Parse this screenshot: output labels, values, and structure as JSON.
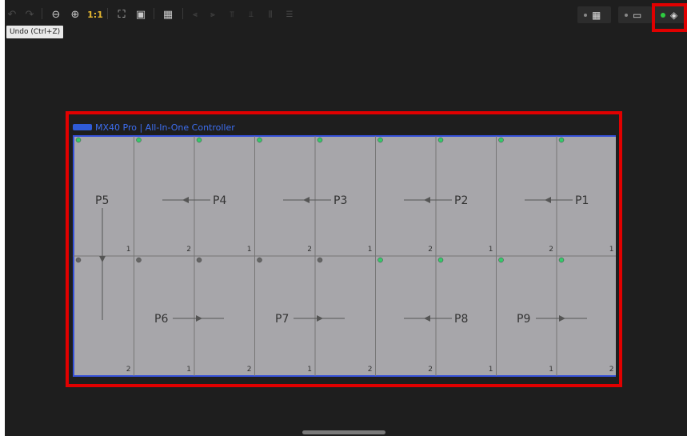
{
  "toolbar": {
    "one_to_one": "1:1",
    "tooltip": "Undo (Ctrl+Z)",
    "icons": [
      "undo-icon",
      "redo-icon",
      "zoom-out-icon",
      "zoom-in-icon",
      "fit-screen-icon",
      "fullscreen-icon",
      "grid-icon",
      "align-left-icon",
      "align-right-icon",
      "align-top-icon",
      "align-bottom-icon",
      "distribute-horizontal-icon",
      "distribute-vertical-icon"
    ],
    "right_toggles": [
      "table-view-icon",
      "preview-icon",
      "layers-icon"
    ]
  },
  "controller": {
    "title": "MX40 Pro | All-In-One Controller"
  },
  "colors": {
    "app_bg": "#1e1e1e",
    "panel_fill": "#a7a6aa",
    "panel_border": "#3550d8",
    "highlight": "#e10000",
    "status_green": "#35c96a"
  },
  "ports": [
    "P5",
    "P4",
    "P3",
    "P2",
    "P1",
    "P6",
    "P7",
    "P8",
    "P9"
  ],
  "cell_numbers": {
    "top": [
      "1",
      "2",
      "1",
      "2",
      "1",
      "2",
      "1",
      "2",
      "1"
    ],
    "bottom": [
      "2",
      "1",
      "2",
      "1",
      "2",
      "2",
      "1",
      "1",
      "2"
    ]
  }
}
